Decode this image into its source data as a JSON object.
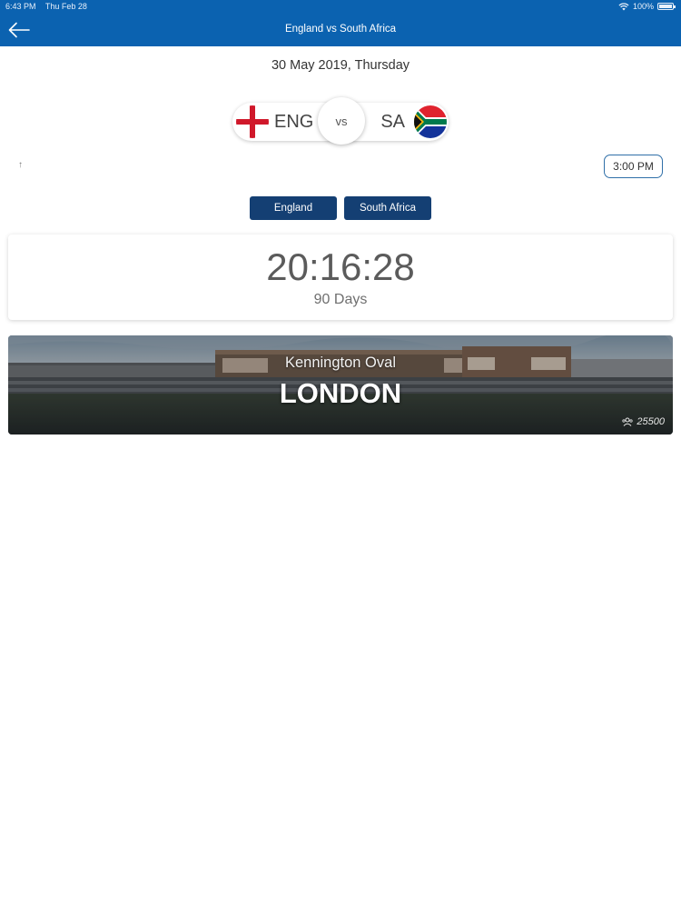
{
  "status_bar": {
    "time": "6:43 PM",
    "date": "Thu Feb 28",
    "battery": "100%",
    "battery_level": 1.0
  },
  "header": {
    "title": "England vs South Africa",
    "back_icon": "arrow-left-icon",
    "background": "#0b62b0"
  },
  "match": {
    "date": "30 May 2019, Thursday",
    "team1": {
      "code": "ENG",
      "flag": "england-flag-icon"
    },
    "vs": "vs",
    "team2": {
      "code": "SA",
      "flag": "south-africa-flag-icon"
    },
    "mark": "↑",
    "time": "3:00 PM"
  },
  "team_buttons": {
    "team1": "England",
    "team2": "South Africa",
    "color": "#143f73"
  },
  "countdown": {
    "time": "20:16:28",
    "days": "90 Days"
  },
  "venue": {
    "name": "Kennington Oval",
    "city": "LONDON",
    "capacity": "25500",
    "capacity_icon": "crowd-icon"
  }
}
